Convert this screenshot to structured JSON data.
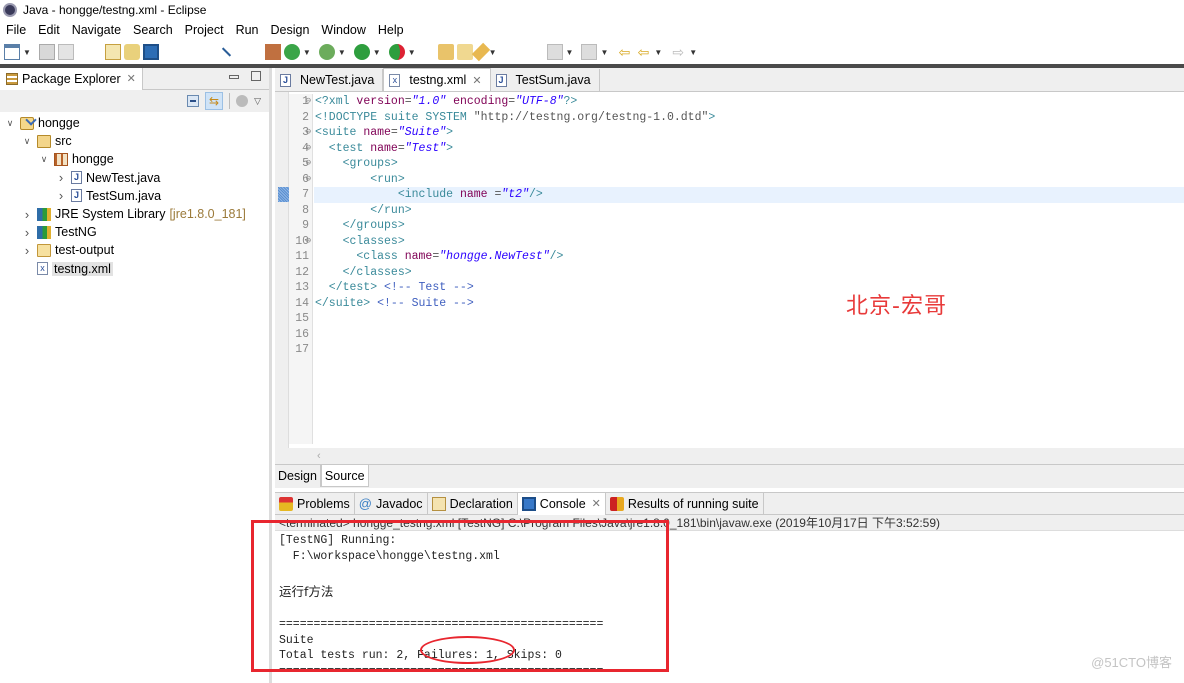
{
  "window": {
    "title": "Java - hongge/testng.xml - Eclipse"
  },
  "menubar": {
    "items": [
      "File",
      "Edit",
      "Navigate",
      "Search",
      "Project",
      "Run",
      "Design",
      "Window",
      "Help"
    ]
  },
  "toolbar": {
    "icons": [
      "new-icon",
      "save-icon",
      "save-all-icon",
      "open-type-icon",
      "sync-icon",
      "console-icon",
      "skip-breakpoints-icon",
      "new-class-icon",
      "coverage-icon",
      "debug-icon",
      "run-icon",
      "external-tools-icon",
      "open-project-icon",
      "open-folder-icon",
      "annotation-icon",
      "next-annotation-icon",
      "prev-annotation-icon",
      "last-edit-icon",
      "back-icon",
      "forward-icon"
    ]
  },
  "package_explorer": {
    "title": "Package Explorer",
    "tree": [
      {
        "label": "hongge",
        "icon": "project-icon",
        "expanded": true,
        "level": 0
      },
      {
        "label": "src",
        "icon": "source-folder-icon",
        "expanded": true,
        "level": 1
      },
      {
        "label": "hongge",
        "icon": "package-icon",
        "expanded": true,
        "level": 2
      },
      {
        "label": "NewTest.java",
        "icon": "java-file-icon",
        "expanded": false,
        "level": 3
      },
      {
        "label": "TestSum.java",
        "icon": "java-file-icon",
        "expanded": false,
        "level": 3
      },
      {
        "label": "JRE System Library",
        "suffix": "[jre1.8.0_181]",
        "icon": "library-icon",
        "expanded": false,
        "level": 1
      },
      {
        "label": "TestNG",
        "icon": "library-icon",
        "expanded": false,
        "level": 1
      },
      {
        "label": "test-output",
        "icon": "folder-icon",
        "expanded": false,
        "level": 1
      },
      {
        "label": "testng.xml",
        "icon": "xml-file-icon",
        "expanded": null,
        "level": 1,
        "selected": true
      }
    ]
  },
  "editor": {
    "tabs": [
      {
        "label": "NewTest.java",
        "icon": "java-file-icon",
        "active": false
      },
      {
        "label": "testng.xml",
        "icon": "xml-file-icon",
        "active": true,
        "closable": true
      },
      {
        "label": "TestSum.java",
        "icon": "java-file-icon",
        "active": false
      }
    ],
    "line_numbers": [
      "1",
      "2",
      "3",
      "4",
      "5",
      "6",
      "7",
      "8",
      "9",
      "10",
      "11",
      "12",
      "13",
      "14",
      "15",
      "16",
      "17"
    ],
    "foldable_lines": [
      1,
      3,
      4,
      5,
      6,
      10
    ],
    "current_line": 7,
    "code_lines": [
      [
        [
          "pi",
          "<?xml "
        ],
        [
          "attr",
          "version"
        ],
        [
          "plain",
          "="
        ],
        [
          "str",
          "\"1.0\""
        ],
        [
          "plain",
          " "
        ],
        [
          "attr",
          "encoding"
        ],
        [
          "plain",
          "="
        ],
        [
          "str",
          "\"UTF-8\""
        ],
        [
          "pi",
          "?>"
        ]
      ],
      [
        [
          "tag",
          "<!DOCTYPE suite SYSTEM "
        ],
        [
          "plain",
          "\"http://testng.org/testng-1.0.dtd\""
        ],
        [
          "tag",
          ">"
        ]
      ],
      [
        [
          "tag",
          "<suite "
        ],
        [
          "attr",
          "name"
        ],
        [
          "plain",
          "="
        ],
        [
          "str",
          "\"Suite\""
        ],
        [
          "tag",
          ">"
        ]
      ],
      [
        [
          "tag",
          "  <test "
        ],
        [
          "attr",
          "name"
        ],
        [
          "plain",
          "="
        ],
        [
          "str",
          "\"Test\""
        ],
        [
          "tag",
          ">"
        ]
      ],
      [
        [
          "tag",
          "    <groups>"
        ]
      ],
      [
        [
          "tag",
          "        <run>"
        ]
      ],
      [
        [
          "tag",
          "            <include "
        ],
        [
          "attr",
          "name"
        ],
        [
          "plain",
          " ="
        ],
        [
          "str",
          "\"t2\""
        ],
        [
          "tag",
          "/>"
        ]
      ],
      [
        [
          "tag",
          "        </run>"
        ]
      ],
      [
        [
          "tag",
          "    </groups>"
        ]
      ],
      [
        [
          "tag",
          "    <classes>"
        ]
      ],
      [
        [
          "tag",
          "      <class "
        ],
        [
          "attr",
          "name"
        ],
        [
          "plain",
          "="
        ],
        [
          "str",
          "\"hongge.NewTest\""
        ],
        [
          "tag",
          "/>"
        ]
      ],
      [
        [
          "tag",
          "    </classes>"
        ]
      ],
      [
        [
          "tag",
          "  </test> "
        ],
        [
          "comment",
          "<!-- Test -->"
        ]
      ],
      [
        [
          "tag",
          "</suite> "
        ],
        [
          "comment",
          "<!-- Suite -->"
        ]
      ],
      [],
      [],
      []
    ],
    "page_tabs": [
      {
        "label": "Design",
        "active": false
      },
      {
        "label": "Source",
        "active": true
      }
    ],
    "annotation": "北京-宏哥"
  },
  "bottom_panel": {
    "tabs": [
      {
        "label": "Problems",
        "icon": "problems-icon",
        "active": false
      },
      {
        "label": "Javadoc",
        "icon": "javadoc-icon",
        "active": false
      },
      {
        "label": "Declaration",
        "icon": "declaration-icon",
        "active": false
      },
      {
        "label": "Console",
        "icon": "console-icon",
        "active": true,
        "closable": true
      },
      {
        "label": "Results of running suite",
        "icon": "testng-icon",
        "active": false
      }
    ],
    "console_header": "<terminated> hongge_testng.xml [TestNG] C:\\Program Files\\Java\\jre1.8.0_181\\bin\\javaw.exe (2019年10月17日 下午3:52:59)",
    "console_lines": [
      {
        "text": "[TestNG] Running:",
        "type": "mono"
      },
      {
        "text": "  F:\\workspace\\hongge\\testng.xml",
        "type": "mono"
      },
      {
        "text": "",
        "type": "blank"
      },
      {
        "text": "运行f方法",
        "type": "cjk"
      },
      {
        "text": "",
        "type": "blank"
      },
      {
        "text": "===============================================",
        "type": "mono"
      },
      {
        "text": "Suite",
        "type": "mono"
      },
      {
        "text": "Total tests run: 2, Failures: 1, Skips: 0",
        "type": "mono"
      },
      {
        "text": "===============================================",
        "type": "mono"
      }
    ]
  },
  "watermark": "@51CTO博客",
  "colors": {
    "highlight_red": "#e8262f",
    "annotation_red": "#e83a3a",
    "xml_tag": "#3a8a9a",
    "xml_attr": "#7f0055",
    "xml_string": "#2a00ff",
    "xml_comment": "#3f5fbf"
  }
}
